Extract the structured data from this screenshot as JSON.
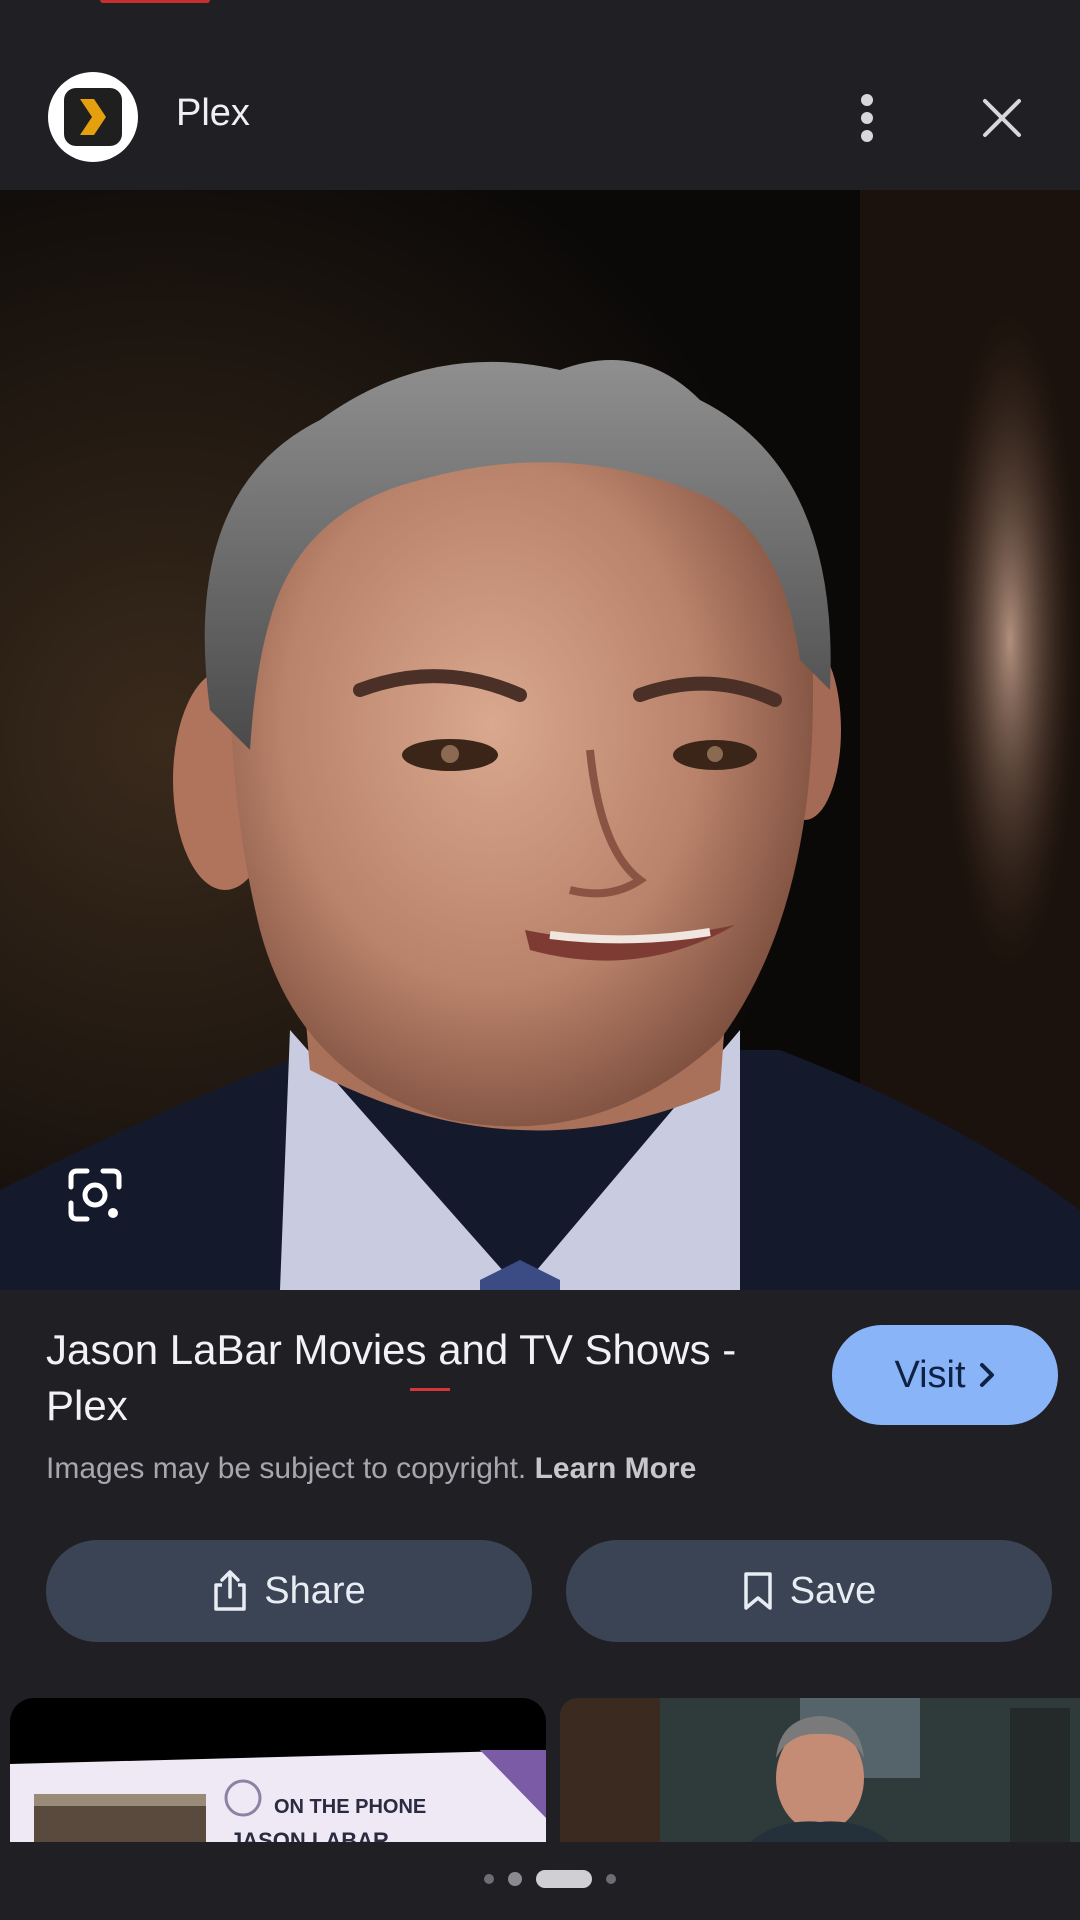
{
  "header": {
    "app_name": "Plex",
    "logo_icon": "plex-chevron-icon",
    "menu_icon": "more-vert-icon",
    "close_icon": "close-icon"
  },
  "hero": {
    "lens_icon": "google-lens-icon"
  },
  "info": {
    "title": "Jason LaBar Movies and TV Shows - Plex",
    "visit_label": "Visit",
    "copyright_text": "Images may be subject to copyright.",
    "learn_more_label": "Learn More"
  },
  "actions": {
    "share_label": "Share",
    "save_label": "Save"
  },
  "thumbnails": {
    "first": {
      "caption_top": "ON THE PHONE",
      "caption_name": "JASON LABAR"
    }
  },
  "colors": {
    "background": "#202024",
    "visit_button": "#8ab4f8",
    "action_button": "#3b4454",
    "plex_yellow": "#e5a00d"
  }
}
